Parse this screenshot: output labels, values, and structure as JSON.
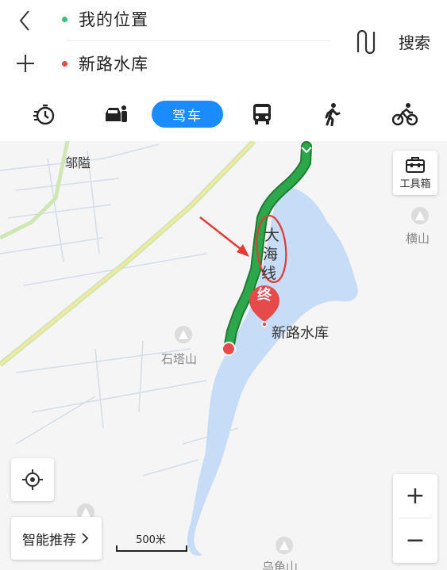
{
  "route": {
    "from_label": "我的位置",
    "to_label": "新路水库",
    "from_dot_color": "#3bbf80",
    "to_dot_color": "#e64a4a",
    "search_label": "搜索"
  },
  "icons": {
    "back": "back-arrow-icon",
    "add": "plus-icon",
    "swap": "swap-route-icon",
    "timer": "stopwatch-icon",
    "carpool": "carpool-icon",
    "bus": "bus-icon",
    "walk": "walking-icon",
    "bike": "bicycle-icon",
    "toolbox": "toolbox-icon",
    "locate": "locate-icon",
    "poi": "mountain-poi-icon"
  },
  "modes": {
    "drive_label": "驾车",
    "active_color": "#1a8cff"
  },
  "map": {
    "labels": {
      "town": "邬隘",
      "mountain_1": "横山",
      "mountain_2": "石塔山",
      "mountain_3": "乌龟山",
      "destination": "新路水库"
    },
    "route_road_chars": [
      "大",
      "海",
      "线"
    ],
    "end_marker": "终",
    "route_color": "#2ca84a",
    "water_color": "#c7dcf6",
    "annotation_color": "#e53935",
    "toolbox_label": "工具箱",
    "smart_recommend_label": "智能推荐",
    "zoom_in": "+",
    "zoom_out": "−",
    "scale_label": "500米"
  }
}
